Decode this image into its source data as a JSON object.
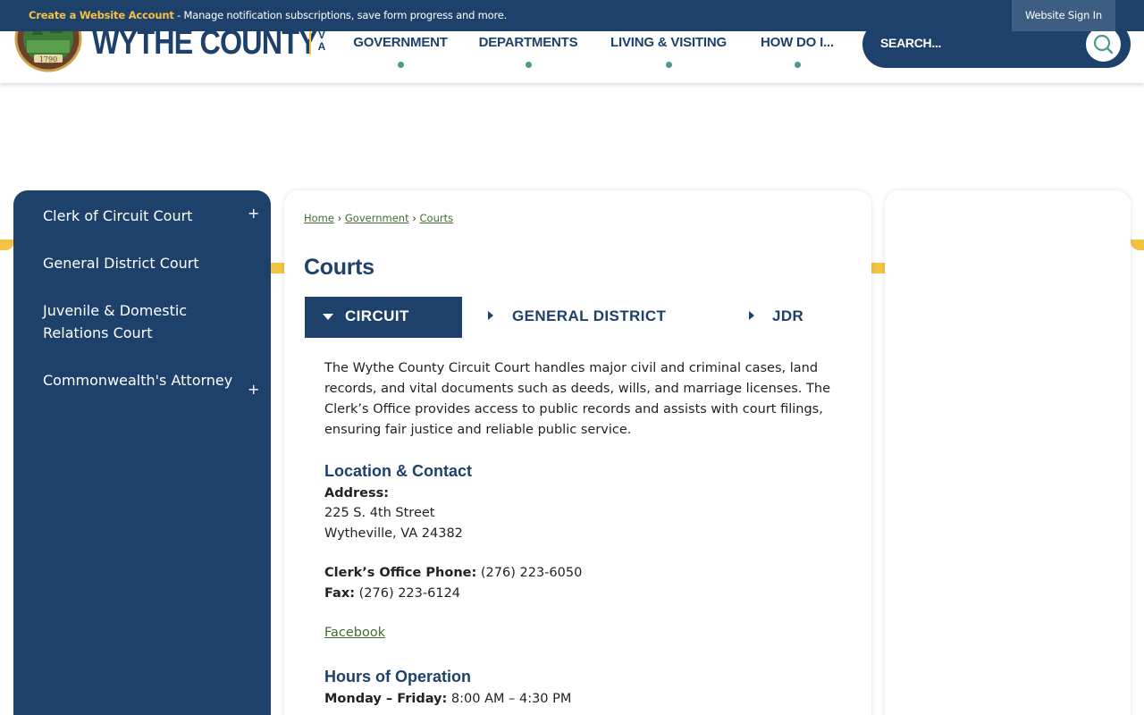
{
  "topbar": {
    "account_link": "Create a Website Account",
    "message": " - Manage notification subscriptions, save form progress and more.",
    "signin": "Website Sign In"
  },
  "header": {
    "brand": "WYTHE COUNTY",
    "brand_state_1": "V",
    "brand_state_2": "A",
    "seal_year": "1790",
    "nav": [
      "GOVERNMENT",
      "DEPARTMENTS",
      "LIVING & VISITING",
      "HOW DO I..."
    ],
    "search_placeholder": "SEARCH..."
  },
  "sidebar": {
    "items": [
      {
        "label": "Clerk of Circuit Court",
        "expandable": true
      },
      {
        "label": "General District Court",
        "expandable": false
      },
      {
        "label": "Juvenile & Domestic Relations Court",
        "expandable": false
      },
      {
        "label": "Commonwealth's Attorney",
        "expandable": true
      }
    ],
    "plus": "+"
  },
  "main": {
    "breadcrumbs": [
      "Home",
      "Government",
      "Courts"
    ],
    "crumb_sep": "›",
    "title": "Courts",
    "tabs": [
      {
        "label": "CIRCUIT",
        "active": true
      },
      {
        "label": "GENERAL DISTRICT",
        "active": false
      },
      {
        "label": "JDR",
        "active": false
      }
    ],
    "intro": "The Wythe County Circuit Court handles major civil and criminal cases, land records, and vital documents such as deeds, wills, and marriage licenses. The Clerk’s Office provides access to public records and assists with court filings, ensuring fair justice and reliable public service.",
    "location_heading": "Location & Contact",
    "address_label": "Address:",
    "address_line1": "225 S. 4th Street",
    "address_line2": "Wytheville, VA 24382",
    "phone_label": "Clerk’s Office Phone:",
    "phone": " (276) 223-6050",
    "fax_label": "Fax:",
    "fax": " (276) 223-6124",
    "facebook": "Facebook",
    "hours_heading": "Hours of Operation",
    "hours_label": "Monday – Friday:",
    "hours": " 8:00 AM – 4:30 PM"
  },
  "colors": {
    "navy": "#1d416b",
    "gold": "#f3c244",
    "teal": "#4a9a8e",
    "link_green": "#446a31"
  }
}
